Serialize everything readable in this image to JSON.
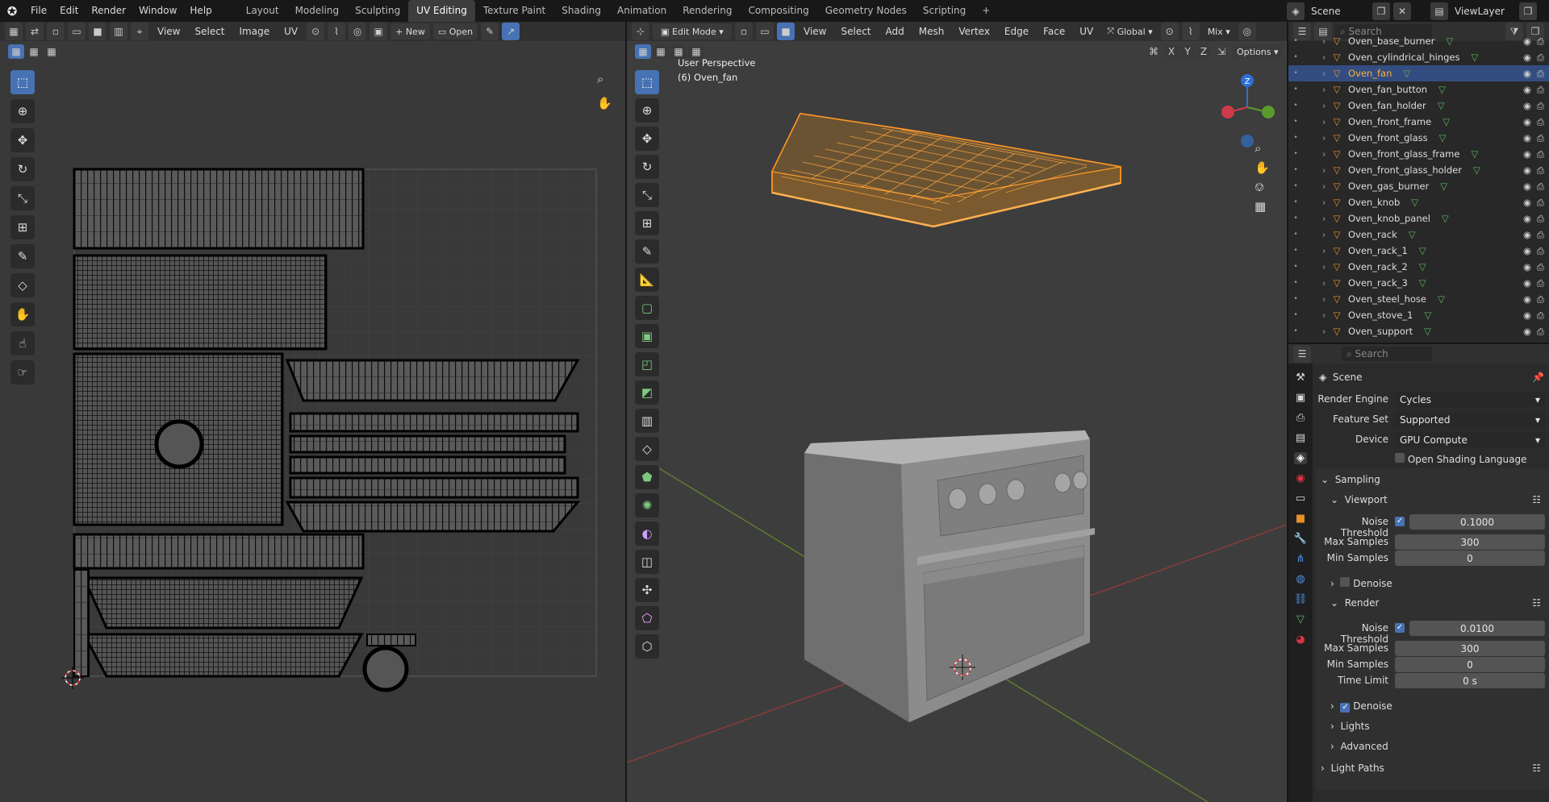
{
  "topbar": {
    "menus": [
      "File",
      "Edit",
      "Render",
      "Window",
      "Help"
    ],
    "workspaces": [
      "Layout",
      "Modeling",
      "Sculpting",
      "UV Editing",
      "Texture Paint",
      "Shading",
      "Animation",
      "Rendering",
      "Compositing",
      "Geometry Nodes",
      "Scripting"
    ],
    "active_workspace": "UV Editing",
    "add_tab": "+",
    "scene": "Scene",
    "view_layer": "ViewLayer"
  },
  "uv_editor": {
    "menus": [
      "View",
      "Select",
      "Image",
      "UV"
    ],
    "new_label": "New",
    "open_label": "Open"
  },
  "viewport": {
    "mode": "Edit Mode",
    "menus": [
      "View",
      "Select",
      "Add",
      "Mesh",
      "Vertex",
      "Edge",
      "Face",
      "UV"
    ],
    "transform_orientation": "Global",
    "overlay_mix": "Mix",
    "options": "Options",
    "axes": [
      "X",
      "Y",
      "Z"
    ],
    "info_line1": "User Perspective",
    "info_line2": "(6) Oven_fan",
    "gizmo": {
      "z": "Z",
      "x": "X",
      "y": "Y"
    }
  },
  "outliner": {
    "search_placeholder": "Search",
    "items": [
      {
        "name": "Oven_base_burner",
        "selected": false
      },
      {
        "name": "Oven_cylindrical_hinges",
        "selected": false
      },
      {
        "name": "Oven_fan",
        "selected": true
      },
      {
        "name": "Oven_fan_button",
        "selected": false
      },
      {
        "name": "Oven_fan_holder",
        "selected": false
      },
      {
        "name": "Oven_front_frame",
        "selected": false
      },
      {
        "name": "Oven_front_glass",
        "selected": false
      },
      {
        "name": "Oven_front_glass_frame",
        "selected": false
      },
      {
        "name": "Oven_front_glass_holder",
        "selected": false
      },
      {
        "name": "Oven_gas_burner",
        "selected": false
      },
      {
        "name": "Oven_knob",
        "selected": false
      },
      {
        "name": "Oven_knob_panel",
        "selected": false
      },
      {
        "name": "Oven_rack",
        "selected": false
      },
      {
        "name": "Oven_rack_1",
        "selected": false
      },
      {
        "name": "Oven_rack_2",
        "selected": false
      },
      {
        "name": "Oven_rack_3",
        "selected": false
      },
      {
        "name": "Oven_steel_hose",
        "selected": false
      },
      {
        "name": "Oven_stove_1",
        "selected": false
      },
      {
        "name": "Oven_support",
        "selected": false
      }
    ]
  },
  "properties": {
    "search_placeholder": "Search",
    "context": "Scene",
    "render_engine_label": "Render Engine",
    "render_engine": "Cycles",
    "feature_set_label": "Feature Set",
    "feature_set": "Supported",
    "device_label": "Device",
    "device": "GPU Compute",
    "osl_label": "Open Shading Language",
    "sampling": "Sampling",
    "viewport": {
      "title": "Viewport",
      "noise_threshold_label": "Noise Threshold",
      "noise_threshold": "0.1000",
      "max_samples_label": "Max Samples",
      "max_samples": "300",
      "min_samples_label": "Min Samples",
      "min_samples": "0",
      "denoise_label": "Denoise"
    },
    "render": {
      "title": "Render",
      "noise_threshold_label": "Noise Threshold",
      "noise_threshold": "0.0100",
      "max_samples_label": "Max Samples",
      "max_samples": "300",
      "min_samples_label": "Min Samples",
      "min_samples": "0",
      "time_limit_label": "Time Limit",
      "time_limit": "0 s",
      "denoise_label": "Denoise"
    },
    "lights": "Lights",
    "advanced": "Advanced",
    "light_paths": "Light Paths"
  },
  "colors": {
    "accent": "#4772b3",
    "selection_orange": "#ff8c1a",
    "header": "#303030",
    "panel_bg": "#2b2b2b"
  }
}
